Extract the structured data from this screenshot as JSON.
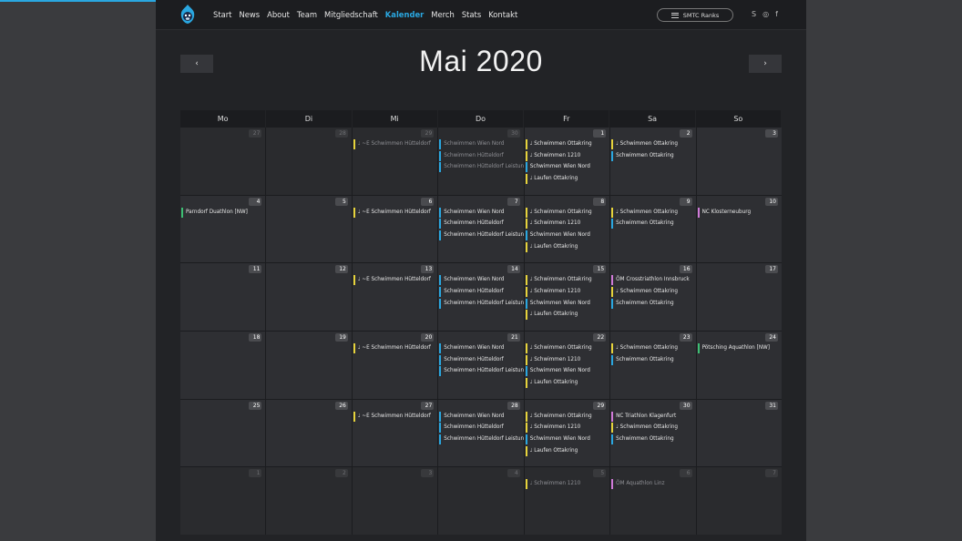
{
  "nav": {
    "items": [
      "Start",
      "News",
      "About",
      "Team",
      "Mitgliedschaft",
      "Kalender",
      "Merch",
      "Stats",
      "Kontakt"
    ],
    "active_index": 5,
    "ranks_label": "SMTC Ranks",
    "social_icons": [
      "strava-icon",
      "instagram-icon",
      "facebook-icon"
    ]
  },
  "calendar": {
    "title": "Mai 2020",
    "prev_label": "‹",
    "next_label": "›",
    "weekdays": [
      "Mo",
      "Di",
      "Mi",
      "Do",
      "Fr",
      "Sa",
      "So"
    ],
    "colors": {
      "swim": "#2aa7e0",
      "run": "#e6d33b",
      "race_green": "#3dbf73",
      "race_pink": "#d07ad8",
      "accent": "#2aa7e0"
    },
    "days": [
      {
        "num": "27",
        "other": true,
        "events": []
      },
      {
        "num": "28",
        "other": true,
        "events": []
      },
      {
        "num": "29",
        "other": true,
        "events": [
          {
            "text": "♩ ~E Schwimmen Hütteldorf",
            "color": "yellow"
          }
        ]
      },
      {
        "num": "30",
        "other": true,
        "events": [
          {
            "text": "Schwimmen Wien Nord",
            "color": "blue"
          },
          {
            "text": "Schwimmen Hütteldorf",
            "color": "blue"
          },
          {
            "text": "Schwimmen Hütteldorf Leistungsgruppe",
            "color": "blue"
          }
        ]
      },
      {
        "num": "1",
        "other": false,
        "events": [
          {
            "text": "♩ Schwimmen Ottakring",
            "color": "yellow"
          },
          {
            "text": "♩ Schwimmen 1210",
            "color": "yellow"
          },
          {
            "text": "Schwimmen Wien Nord",
            "color": "blue"
          },
          {
            "text": "♩ Laufen Ottakring",
            "color": "yellow"
          }
        ]
      },
      {
        "num": "2",
        "other": false,
        "events": [
          {
            "text": "♩ Schwimmen Ottakring",
            "color": "yellow"
          },
          {
            "text": "Schwimmen Ottakring",
            "color": "blue"
          }
        ]
      },
      {
        "num": "3",
        "other": false,
        "events": []
      },
      {
        "num": "4",
        "other": false,
        "events": [
          {
            "text": "Parndorf Duathlon [NW]",
            "color": "green"
          }
        ]
      },
      {
        "num": "5",
        "other": false,
        "events": []
      },
      {
        "num": "6",
        "other": false,
        "events": [
          {
            "text": "♩ ~E Schwimmen Hütteldorf",
            "color": "yellow"
          }
        ]
      },
      {
        "num": "7",
        "other": false,
        "events": [
          {
            "text": "Schwimmen Wien Nord",
            "color": "blue"
          },
          {
            "text": "Schwimmen Hütteldorf",
            "color": "blue"
          },
          {
            "text": "Schwimmen Hütteldorf Leistungsgruppe",
            "color": "blue"
          }
        ]
      },
      {
        "num": "8",
        "other": false,
        "events": [
          {
            "text": "♩ Schwimmen Ottakring",
            "color": "yellow"
          },
          {
            "text": "♩ Schwimmen 1210",
            "color": "yellow"
          },
          {
            "text": "Schwimmen Wien Nord",
            "color": "blue"
          },
          {
            "text": "♩ Laufen Ottakring",
            "color": "yellow"
          }
        ]
      },
      {
        "num": "9",
        "other": false,
        "events": [
          {
            "text": "♩ Schwimmen Ottakring",
            "color": "yellow"
          },
          {
            "text": "Schwimmen Ottakring",
            "color": "blue"
          }
        ]
      },
      {
        "num": "10",
        "other": false,
        "events": [
          {
            "text": "NC Klosterneuburg",
            "color": "pink"
          }
        ]
      },
      {
        "num": "11",
        "other": false,
        "events": []
      },
      {
        "num": "12",
        "other": false,
        "events": []
      },
      {
        "num": "13",
        "other": false,
        "events": [
          {
            "text": "♩ ~E Schwimmen Hütteldorf",
            "color": "yellow"
          }
        ]
      },
      {
        "num": "14",
        "other": false,
        "events": [
          {
            "text": "Schwimmen Wien Nord",
            "color": "blue"
          },
          {
            "text": "Schwimmen Hütteldorf",
            "color": "blue"
          },
          {
            "text": "Schwimmen Hütteldorf Leistungsgruppe",
            "color": "blue"
          }
        ]
      },
      {
        "num": "15",
        "other": false,
        "events": [
          {
            "text": "♩ Schwimmen Ottakring",
            "color": "yellow"
          },
          {
            "text": "♩ Schwimmen 1210",
            "color": "yellow"
          },
          {
            "text": "Schwimmen Wien Nord",
            "color": "blue"
          },
          {
            "text": "♩ Laufen Ottakring",
            "color": "yellow"
          }
        ]
      },
      {
        "num": "16",
        "other": false,
        "events": [
          {
            "text": "ÖM Crosstriathlon Innsbruck",
            "color": "pink"
          },
          {
            "text": "♩ Schwimmen Ottakring",
            "color": "yellow"
          },
          {
            "text": "Schwimmen Ottakring",
            "color": "blue"
          }
        ]
      },
      {
        "num": "17",
        "other": false,
        "events": []
      },
      {
        "num": "18",
        "other": false,
        "events": []
      },
      {
        "num": "19",
        "other": false,
        "events": []
      },
      {
        "num": "20",
        "other": false,
        "events": [
          {
            "text": "♩ ~E Schwimmen Hütteldorf",
            "color": "yellow"
          }
        ]
      },
      {
        "num": "21",
        "other": false,
        "events": [
          {
            "text": "Schwimmen Wien Nord",
            "color": "blue"
          },
          {
            "text": "Schwimmen Hütteldorf",
            "color": "blue"
          },
          {
            "text": "Schwimmen Hütteldorf Leistungsgruppe",
            "color": "blue"
          }
        ]
      },
      {
        "num": "22",
        "other": false,
        "events": [
          {
            "text": "♩ Schwimmen Ottakring",
            "color": "yellow"
          },
          {
            "text": "♩ Schwimmen 1210",
            "color": "yellow"
          },
          {
            "text": "Schwimmen Wien Nord",
            "color": "blue"
          },
          {
            "text": "♩ Laufen Ottakring",
            "color": "yellow"
          }
        ]
      },
      {
        "num": "23",
        "other": false,
        "events": [
          {
            "text": "♩ Schwimmen Ottakring",
            "color": "yellow"
          },
          {
            "text": "Schwimmen Ottakring",
            "color": "blue"
          }
        ]
      },
      {
        "num": "24",
        "other": false,
        "events": [
          {
            "text": "Pötsching Aquathlon [NW]",
            "color": "green"
          }
        ]
      },
      {
        "num": "25",
        "other": false,
        "events": []
      },
      {
        "num": "26",
        "other": false,
        "events": []
      },
      {
        "num": "27",
        "other": false,
        "events": [
          {
            "text": "♩ ~E Schwimmen Hütteldorf",
            "color": "yellow"
          }
        ]
      },
      {
        "num": "28",
        "other": false,
        "events": [
          {
            "text": "Schwimmen Wien Nord",
            "color": "blue"
          },
          {
            "text": "Schwimmen Hütteldorf",
            "color": "blue"
          },
          {
            "text": "Schwimmen Hütteldorf Leistungsgruppe",
            "color": "blue"
          }
        ]
      },
      {
        "num": "29",
        "other": false,
        "events": [
          {
            "text": "♩ Schwimmen Ottakring",
            "color": "yellow"
          },
          {
            "text": "♩ Schwimmen 1210",
            "color": "yellow"
          },
          {
            "text": "Schwimmen Wien Nord",
            "color": "blue"
          },
          {
            "text": "♩ Laufen Ottakring",
            "color": "yellow"
          }
        ]
      },
      {
        "num": "30",
        "other": false,
        "events": [
          {
            "text": "NC Triathlon Klagenfurt",
            "color": "pink"
          },
          {
            "text": "♩ Schwimmen Ottakring",
            "color": "yellow"
          },
          {
            "text": "Schwimmen Ottakring",
            "color": "blue"
          }
        ]
      },
      {
        "num": "31",
        "other": false,
        "events": []
      },
      {
        "num": "1",
        "other": true,
        "events": []
      },
      {
        "num": "2",
        "other": true,
        "events": []
      },
      {
        "num": "3",
        "other": true,
        "events": []
      },
      {
        "num": "4",
        "other": true,
        "events": []
      },
      {
        "num": "5",
        "other": true,
        "events": [
          {
            "text": "♩ Schwimmen 1210",
            "color": "yellow"
          }
        ]
      },
      {
        "num": "6",
        "other": true,
        "events": [
          {
            "text": "ÖM Aquathlon Linz",
            "color": "pink"
          }
        ]
      },
      {
        "num": "7",
        "other": true,
        "events": []
      }
    ]
  }
}
